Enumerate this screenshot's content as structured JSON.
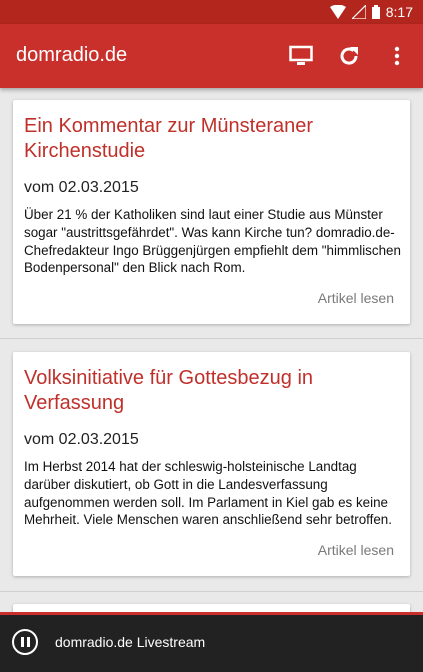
{
  "status_bar": {
    "time": "8:17"
  },
  "app_bar": {
    "title": "domradio.de"
  },
  "articles": [
    {
      "title": "Ein Kommentar zur Münsteraner Kirchenstudie",
      "date": "vom 02.03.2015",
      "teaser": "Über 21 % der Katholiken sind laut einer Studie aus Münster sogar \"austrittsgefährdet\". Was kann Kirche tun? domradio.de-Chefredakteur Ingo Brüggenjürgen empfiehlt dem \"himmlischen Bodenpersonal\" den Blick nach Rom.",
      "link": "Artikel lesen"
    },
    {
      "title": "Volksinitiative für Gottesbezug in Verfassung",
      "date": "vom 02.03.2015",
      "teaser": "Im Herbst 2014 hat der schleswig-holsteinische Landtag darüber diskutiert, ob Gott in die Landesverfassung aufgenommen werden soll. Im Parlament in Kiel gab es keine Mehrheit. Viele Menschen waren anschließend sehr betroffen.",
      "link": "Artikel lesen"
    }
  ],
  "player": {
    "label": "domradio.de Livestream"
  },
  "icons": {
    "wifi": "wifi-icon",
    "signal": "signal-icon",
    "battery": "battery-icon",
    "cast": "cast-icon",
    "refresh": "refresh-icon",
    "overflow": "more-vert-icon",
    "pause": "pause-icon"
  },
  "colors": {
    "appbar": "#c9302c",
    "statusbar": "#b3261e",
    "title_red": "#c0302a",
    "player_bg": "#222222"
  }
}
